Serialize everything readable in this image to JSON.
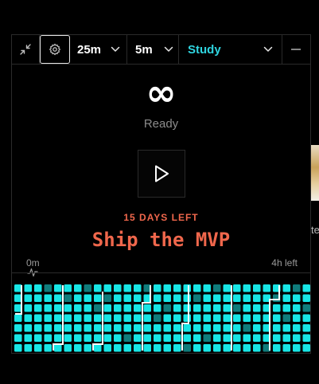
{
  "toolbar": {
    "work_duration": "25m",
    "break_duration": "5m",
    "project": "Study"
  },
  "timer": {
    "display": "∞",
    "status": "Ready"
  },
  "goal": {
    "days_left": "15 DAYS LEFT",
    "title": "Ship the MVP"
  },
  "progress": {
    "start_label": "0m",
    "end_label": "4h left"
  },
  "background": {
    "peek_text": "te"
  },
  "colors": {
    "accent": "#17e6e6",
    "goal": "#f0674c",
    "cell_bright": "#17e6e6",
    "cell_dim": "#0f7c7c",
    "marker": "#ffffff",
    "project": "#2fd5e0"
  },
  "icons": [
    "collapse-icon",
    "gear-icon",
    "chevron-down-icon",
    "minimize-icon",
    "play-icon",
    "pulse-icon"
  ]
}
